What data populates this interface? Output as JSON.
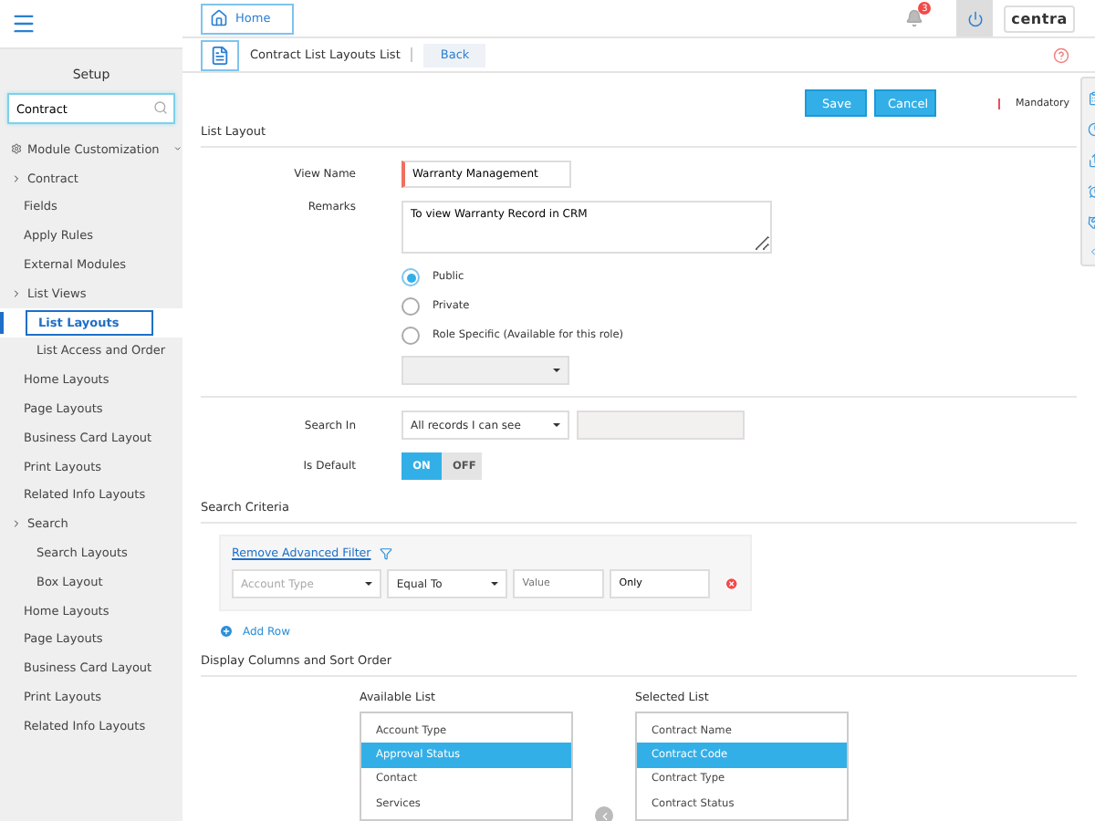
{
  "topbar": {
    "home": "Home",
    "notification_count": "3",
    "logo": "centra"
  },
  "sidebar": {
    "title": "Setup",
    "search": {
      "value": "Contract"
    },
    "items": [
      {
        "label": "Module Customization",
        "kind": "module",
        "expanded": true,
        "children": [
          {
            "label": "Contract",
            "kind": "toggle",
            "selected": false
          },
          {
            "label": "Fields",
            "kind": "link",
            "selected": false
          },
          {
            "label": "Apply Rules",
            "kind": "link",
            "selected": false
          },
          {
            "label": "External Modules",
            "kind": "link",
            "selected": false
          },
          {
            "label": "List Views",
            "kind": "toggle",
            "selected": false,
            "children": [
              {
                "label": "List Layouts",
                "kind": "link",
                "selected": true
              },
              {
                "label": "List Access and Order",
                "kind": "link",
                "selected": false
              }
            ]
          },
          {
            "label": "Home Layouts",
            "kind": "link",
            "selected": false
          },
          {
            "label": "Page Layouts",
            "kind": "link",
            "selected": false
          },
          {
            "label": "Business Card Layout",
            "kind": "link",
            "selected": false
          },
          {
            "label": "Print Layouts",
            "kind": "link",
            "selected": false
          },
          {
            "label": "Related Info Layouts",
            "kind": "link",
            "selected": false
          },
          {
            "label": "Search",
            "kind": "toggle",
            "selected": false,
            "children": [
              {
                "label": "Search Layouts",
                "kind": "link",
                "selected": false
              },
              {
                "label": "Box Layout",
                "kind": "link",
                "selected": false
              }
            ]
          },
          {
            "label": "Home Layouts",
            "kind": "link",
            "selected": false
          },
          {
            "label": "Page Layouts",
            "kind": "link",
            "selected": false
          },
          {
            "label": "Business Card Layout",
            "kind": "link",
            "selected": false
          },
          {
            "label": "Print Layouts",
            "kind": "link",
            "selected": false
          },
          {
            "label": "Related Info Layouts",
            "kind": "link",
            "selected": false
          }
        ]
      }
    ]
  },
  "subheader": {
    "title": "Contract List Layouts List",
    "back": "Back"
  },
  "actions": {
    "save": "Save",
    "cancel": "Cancel",
    "mandatory": "Mandatory"
  },
  "list_layout": {
    "heading": "List Layout",
    "view_name": {
      "label": "View Name",
      "value": "Warranty Management"
    },
    "remarks": {
      "label": "Remarks",
      "value": "To view Warranty Record in CRM"
    },
    "visibility": [
      {
        "label": "Public",
        "selected": true
      },
      {
        "label": "Private",
        "selected": false
      },
      {
        "label": "Role Specific (Available for this role)",
        "selected": false
      }
    ],
    "search_in": {
      "label": "Search In",
      "value": "All records I can see"
    },
    "is_default": {
      "label": "Is Default",
      "options": [
        {
          "label": "ON",
          "selected": true
        },
        {
          "label": "OFF",
          "selected": false
        }
      ]
    }
  },
  "search_criteria": {
    "heading": "Search Criteria",
    "remove_filter": "Remove Advanced Filter",
    "rows": [
      {
        "field": {
          "placeholder": "Account Type"
        },
        "operator": "Equal To",
        "value": {
          "placeholder": "Value"
        },
        "extra": "Only"
      }
    ],
    "add_row": "Add Row"
  },
  "display_columns": {
    "heading": "Display Columns and Sort Order",
    "available": {
      "title": "Available List",
      "items": [
        {
          "label": "Account Type",
          "selected": false
        },
        {
          "label": "Approval Status",
          "selected": true
        },
        {
          "label": "Contact",
          "selected": false
        },
        {
          "label": "Services",
          "selected": false
        }
      ]
    },
    "selected": {
      "title": "Selected List",
      "items": [
        {
          "label": "Contract Name",
          "selected": false
        },
        {
          "label": "Contract Code",
          "selected": true
        },
        {
          "label": "Contract Type",
          "selected": false
        },
        {
          "label": "Contract Status",
          "selected": false
        }
      ]
    }
  }
}
